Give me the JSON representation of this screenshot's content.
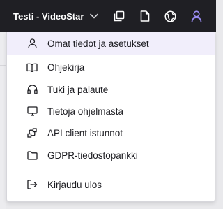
{
  "colors": {
    "topbar_bg": "#1f1f24",
    "accent": "#9b8cf5",
    "highlight_bg": "#f1eefb",
    "menu_bg": "#ffffff",
    "text": "#1c1c21"
  },
  "topbar": {
    "workspace_name": "Testi - VideoStar",
    "icons": [
      "chevron-down-icon",
      "copy-icon",
      "document-icon",
      "globe-icon",
      "user-icon"
    ]
  },
  "menu": {
    "items": [
      {
        "label": "Omat tiedot ja asetukset",
        "icon": "user-icon",
        "highlighted": true
      },
      {
        "label": "Ohjekirja",
        "icon": "book-icon"
      },
      {
        "label": "Tuki ja palaute",
        "icon": "headset-icon"
      },
      {
        "label": "Tietoja ohjelmasta",
        "icon": "monitor-icon"
      },
      {
        "label": "API client istunnot",
        "icon": "api-icon"
      },
      {
        "label": "GDPR-tiedostopankki",
        "icon": "folder-icon"
      }
    ],
    "logout": {
      "label": "Kirjaudu ulos",
      "icon": "logout-icon"
    }
  }
}
